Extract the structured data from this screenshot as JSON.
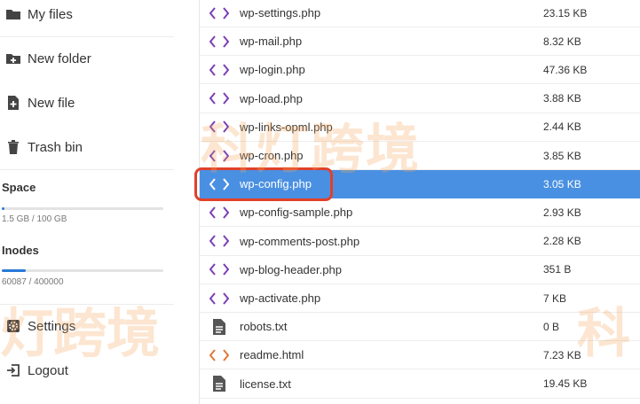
{
  "sidebar": {
    "items": [
      {
        "label": "My files",
        "icon": "folder-icon"
      },
      {
        "label": "New folder",
        "icon": "folder-plus-icon"
      },
      {
        "label": "New file",
        "icon": "file-plus-icon"
      },
      {
        "label": "Trash bin",
        "icon": "trash-icon"
      }
    ],
    "space": {
      "title": "Space",
      "text": "1.5 GB / 100 GB",
      "fraction": 0.015
    },
    "inodes": {
      "title": "Inodes",
      "text": "60087 / 400000",
      "fraction": 0.15
    },
    "settings": {
      "label": "Settings",
      "icon": "gear-icon"
    },
    "logout": {
      "label": "Logout",
      "icon": "logout-icon"
    }
  },
  "files": [
    {
      "name": "wp-settings.php",
      "size": "23.15 KB",
      "type": "code"
    },
    {
      "name": "wp-mail.php",
      "size": "8.32 KB",
      "type": "code"
    },
    {
      "name": "wp-login.php",
      "size": "47.36 KB",
      "type": "code"
    },
    {
      "name": "wp-load.php",
      "size": "3.88 KB",
      "type": "code"
    },
    {
      "name": "wp-links-opml.php",
      "size": "2.44 KB",
      "type": "code"
    },
    {
      "name": "wp-cron.php",
      "size": "3.85 KB",
      "type": "code"
    },
    {
      "name": "wp-config.php",
      "size": "3.05 KB",
      "type": "code",
      "selected": true
    },
    {
      "name": "wp-config-sample.php",
      "size": "2.93 KB",
      "type": "code"
    },
    {
      "name": "wp-comments-post.php",
      "size": "2.28 KB",
      "type": "code"
    },
    {
      "name": "wp-blog-header.php",
      "size": "351 B",
      "type": "code"
    },
    {
      "name": "wp-activate.php",
      "size": "7 KB",
      "type": "code"
    },
    {
      "name": "robots.txt",
      "size": "0 B",
      "type": "text"
    },
    {
      "name": "readme.html",
      "size": "7.23 KB",
      "type": "html"
    },
    {
      "name": "license.txt",
      "size": "19.45 KB",
      "type": "text"
    }
  ],
  "colors": {
    "code_icon": "#7b3fb5",
    "html_icon": "#e0783a",
    "text_icon": "#555555",
    "selected_row": "#4a90e2",
    "highlight_border": "#e1412a"
  },
  "watermark": {
    "text_main": "科灯跨境",
    "text_side": "灯跨境",
    "text_right": "科"
  }
}
